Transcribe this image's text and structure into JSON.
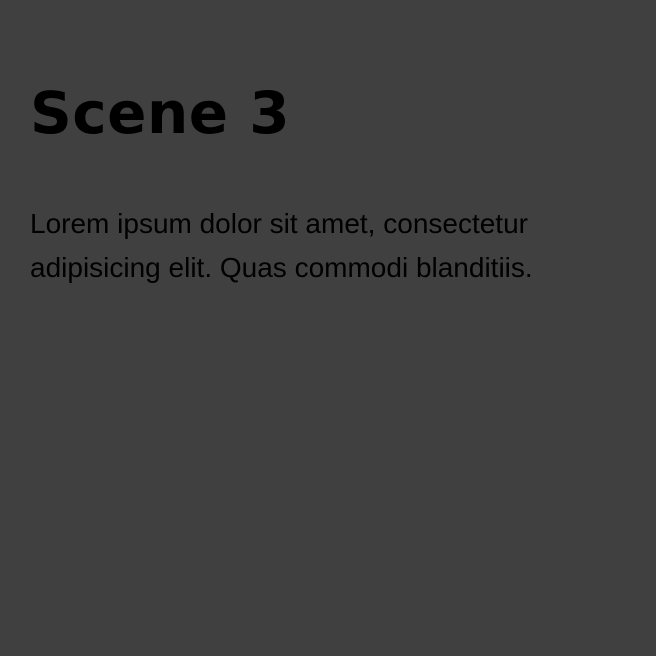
{
  "colors": {
    "background": "#404040",
    "text": "#000000"
  },
  "scene": {
    "title": "Scene 3",
    "body_line_1": "Lorem ipsum dolor sit amet, consectetur",
    "body_line_2": "adipisicing elit. Quas commodi blanditiis."
  }
}
